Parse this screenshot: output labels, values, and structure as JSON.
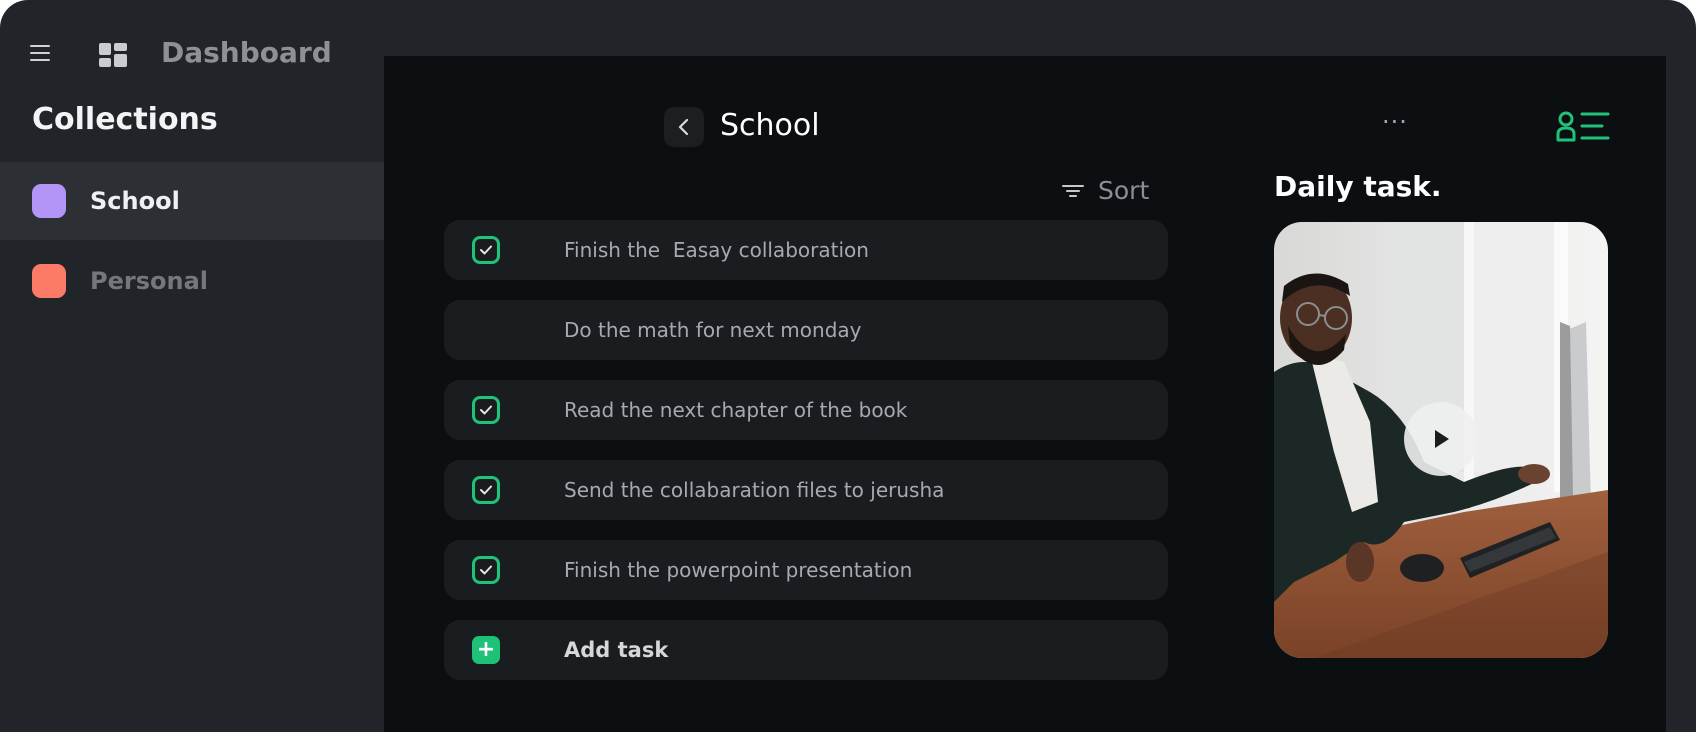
{
  "header": {
    "title": "Dashboard",
    "menu_icon": "hamburger-menu-icon",
    "dashboard_icon": "dashboard-grid-icon"
  },
  "sidebar": {
    "heading": "Collections",
    "items": [
      {
        "label": "School",
        "color": "#b394f7",
        "active": true
      },
      {
        "label": "Personal",
        "color": "#fb7a68",
        "active": false
      }
    ]
  },
  "main": {
    "title": "School",
    "back_icon": "chevron-left-icon",
    "more_icon": "more-horizontal-icon",
    "more_glyph": "···",
    "profile_icon": "user-list-icon",
    "sort_label": "Sort",
    "sort_icon": "filter-lines-icon",
    "tasks": [
      {
        "text": "Finish the  Easay collaboration",
        "checked": true
      },
      {
        "text": "Do the math for next monday",
        "checked": false
      },
      {
        "text": "Read the next chapter of the book",
        "checked": true
      },
      {
        "text": "Send the collabaration files to jerusha",
        "checked": true
      },
      {
        "text": "Finish the powerpoint presentation",
        "checked": true
      }
    ],
    "add_task_label": "Add task",
    "add_icon_glyph": "+"
  },
  "daily": {
    "title": "Daily task.",
    "video_thumbnail": "man-at-desk-with-computer-photo",
    "play_icon": "play-icon"
  },
  "colors": {
    "accent_green": "#20c27a",
    "sidebar_bg": "#212428",
    "main_bg": "#0c0f11",
    "task_bg": "#1a1d20"
  }
}
